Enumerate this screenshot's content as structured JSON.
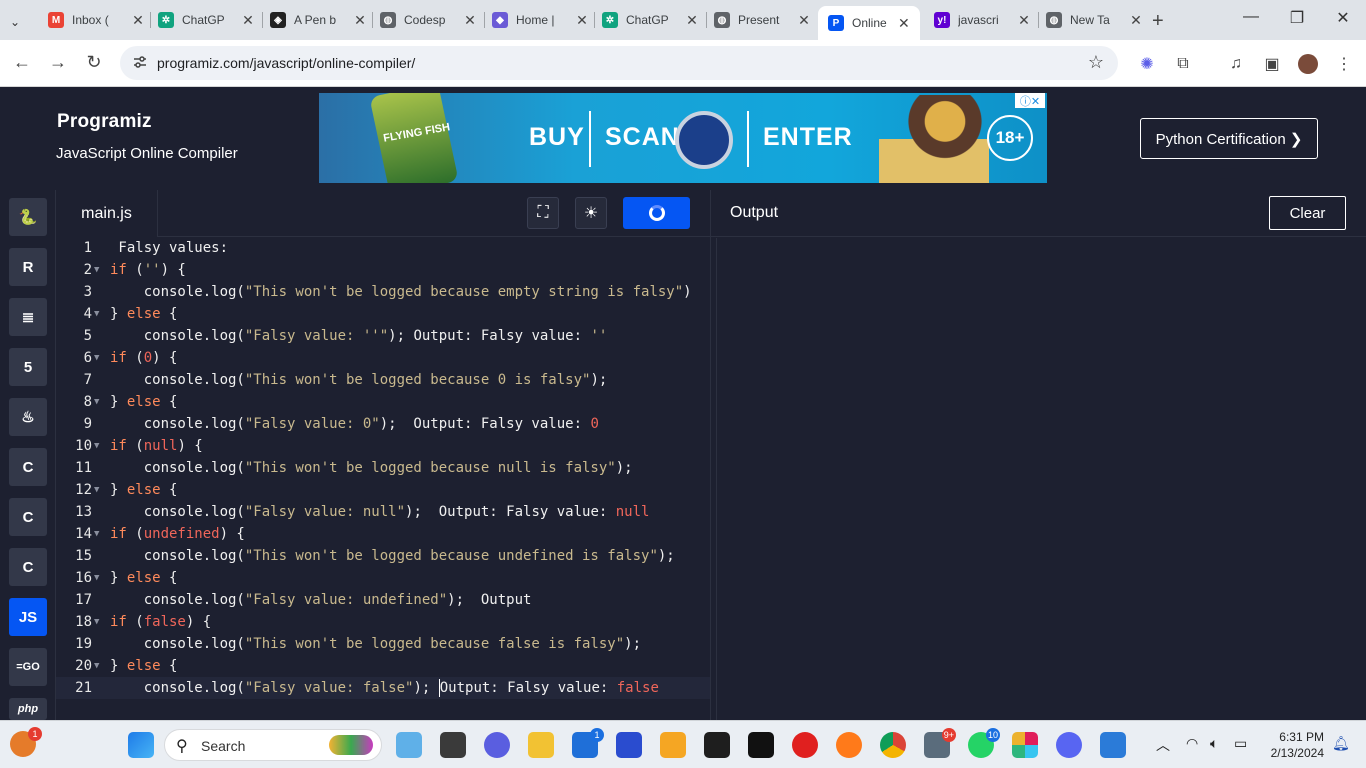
{
  "browser": {
    "tabs": [
      {
        "title": "Inbox (",
        "icon": "gmail-icon",
        "color": "#ea4335",
        "glyph": "M"
      },
      {
        "title": "ChatGP",
        "icon": "chatgpt-icon",
        "color": "#10a37f",
        "glyph": "✲"
      },
      {
        "title": "A Pen b",
        "icon": "codepen-icon",
        "color": "#222222",
        "glyph": "◈"
      },
      {
        "title": "Codesp",
        "icon": "globe-icon",
        "color": "#5f6368",
        "glyph": "◍"
      },
      {
        "title": "Home |",
        "icon": "home-icon",
        "color": "#6b5bd6",
        "glyph": "◆"
      },
      {
        "title": "ChatGP",
        "icon": "chatgpt-icon",
        "color": "#10a37f",
        "glyph": "✲"
      },
      {
        "title": "Present",
        "icon": "globe-icon",
        "color": "#5f6368",
        "glyph": "◍"
      },
      {
        "title": "Online",
        "icon": "programiz-icon",
        "color": "#0556f3",
        "glyph": "P",
        "active": true
      },
      {
        "title": "javascri",
        "icon": "yahoo-icon",
        "color": "#6001d2",
        "glyph": "y!"
      },
      {
        "title": "New Ta",
        "icon": "globe-icon",
        "color": "#5f6368",
        "glyph": "◍"
      }
    ],
    "url": "programiz.com/javascript/online-compiler/"
  },
  "header": {
    "logo": "Programiz",
    "subtitle": "JavaScript Online Compiler",
    "cert_button": "Python Certification ❯"
  },
  "ad": {
    "brand": "FLYING FISH",
    "words": [
      "BUY",
      "SCAN",
      "ENTER"
    ],
    "age": "18+"
  },
  "languages": [
    {
      "name": "python-icon",
      "glyph": "🐍"
    },
    {
      "name": "r-icon",
      "glyph": "R"
    },
    {
      "name": "sql-icon",
      "glyph": "≣"
    },
    {
      "name": "html-icon",
      "glyph": "5"
    },
    {
      "name": "java-icon",
      "glyph": "♨"
    },
    {
      "name": "c-icon",
      "glyph": "C"
    },
    {
      "name": "cpp-icon",
      "glyph": "C"
    },
    {
      "name": "csharp-icon",
      "glyph": "C"
    },
    {
      "name": "js-icon",
      "glyph": "JS",
      "active": true
    },
    {
      "name": "go-icon",
      "glyph": "=GO"
    },
    {
      "name": "php-icon",
      "glyph": "php"
    }
  ],
  "editor": {
    "filename": "main.js",
    "lines": [
      [
        [
          "",
          " Falsy values:"
        ]
      ],
      [
        [
          "kw",
          "if"
        ],
        [
          "",
          " ("
        ],
        [
          "str",
          "''"
        ],
        [
          "",
          ") {"
        ]
      ],
      [
        [
          "",
          "    console.log("
        ],
        [
          "str",
          "\"This won't be logged because empty string is falsy\""
        ],
        [
          "",
          ")"
        ]
      ],
      [
        [
          "",
          "} "
        ],
        [
          "kw",
          "else"
        ],
        [
          "",
          " {"
        ]
      ],
      [
        [
          "",
          "    console.log("
        ],
        [
          "str",
          "\"Falsy value: ''\""
        ],
        [
          "",
          "); Output: Falsy value: "
        ],
        [
          "str",
          "''"
        ]
      ],
      [
        [
          "kw",
          "if"
        ],
        [
          "",
          " ("
        ],
        [
          "nul",
          "0"
        ],
        [
          "",
          ") {"
        ]
      ],
      [
        [
          "",
          "    console.log("
        ],
        [
          "str",
          "\"This won't be logged because 0 is falsy\""
        ],
        [
          "",
          ");"
        ]
      ],
      [
        [
          "",
          "} "
        ],
        [
          "kw",
          "else"
        ],
        [
          "",
          " {"
        ]
      ],
      [
        [
          "",
          "    console.log("
        ],
        [
          "str",
          "\"Falsy value: 0\""
        ],
        [
          "",
          ");  Output: Falsy value: "
        ],
        [
          "nul",
          "0"
        ]
      ],
      [
        [
          "kw",
          "if"
        ],
        [
          "",
          " ("
        ],
        [
          "nul",
          "null"
        ],
        [
          "",
          ") {"
        ]
      ],
      [
        [
          "",
          "    console.log("
        ],
        [
          "str",
          "\"This won't be logged because null is falsy\""
        ],
        [
          "",
          ");"
        ]
      ],
      [
        [
          "",
          "} "
        ],
        [
          "kw",
          "else"
        ],
        [
          "",
          " {"
        ]
      ],
      [
        [
          "",
          "    console.log("
        ],
        [
          "str",
          "\"Falsy value: null\""
        ],
        [
          "",
          ");  Output: Falsy value: "
        ],
        [
          "nul",
          "null"
        ]
      ],
      [
        [
          "kw",
          "if"
        ],
        [
          "",
          " ("
        ],
        [
          "nul",
          "undefined"
        ],
        [
          "",
          ") {"
        ]
      ],
      [
        [
          "",
          "    console.log("
        ],
        [
          "str",
          "\"This won't be logged because undefined is falsy\""
        ],
        [
          "",
          ");"
        ]
      ],
      [
        [
          "",
          "} "
        ],
        [
          "kw",
          "else"
        ],
        [
          "",
          " {"
        ]
      ],
      [
        [
          "",
          "    console.log("
        ],
        [
          "str",
          "\"Falsy value: undefined\""
        ],
        [
          "",
          ");  Output"
        ]
      ],
      [
        [
          "kw",
          "if"
        ],
        [
          "",
          " ("
        ],
        [
          "nul",
          "false"
        ],
        [
          "",
          ") {"
        ]
      ],
      [
        [
          "",
          "    console.log("
        ],
        [
          "str",
          "\"This won't be logged because false is falsy\""
        ],
        [
          "",
          ");"
        ]
      ],
      [
        [
          "",
          "} "
        ],
        [
          "kw",
          "else"
        ],
        [
          "",
          " {"
        ]
      ],
      [
        [
          "",
          "    console.log("
        ],
        [
          "str",
          "\"Falsy value: false\""
        ],
        [
          "",
          "); "
        ],
        [
          "caret",
          ""
        ],
        [
          "",
          "Output: Falsy value: "
        ],
        [
          "nul",
          "false"
        ]
      ]
    ],
    "folds": [
      2,
      4,
      6,
      8,
      10,
      12,
      14,
      16,
      18,
      20
    ]
  },
  "output": {
    "title": "Output",
    "clear_label": "Clear"
  },
  "taskbar": {
    "search_label": "Search",
    "time": "6:31 PM",
    "date": "2/13/2024",
    "badges": {
      "opera": "1",
      "store": "1",
      "teams": "9+",
      "whatsapp": "10"
    }
  },
  "colors": {
    "bg": "#1d2030",
    "accent": "#0556f3",
    "keyword": "#ff8a5b",
    "string": "#c9b98e",
    "literal": "#f0665a"
  }
}
